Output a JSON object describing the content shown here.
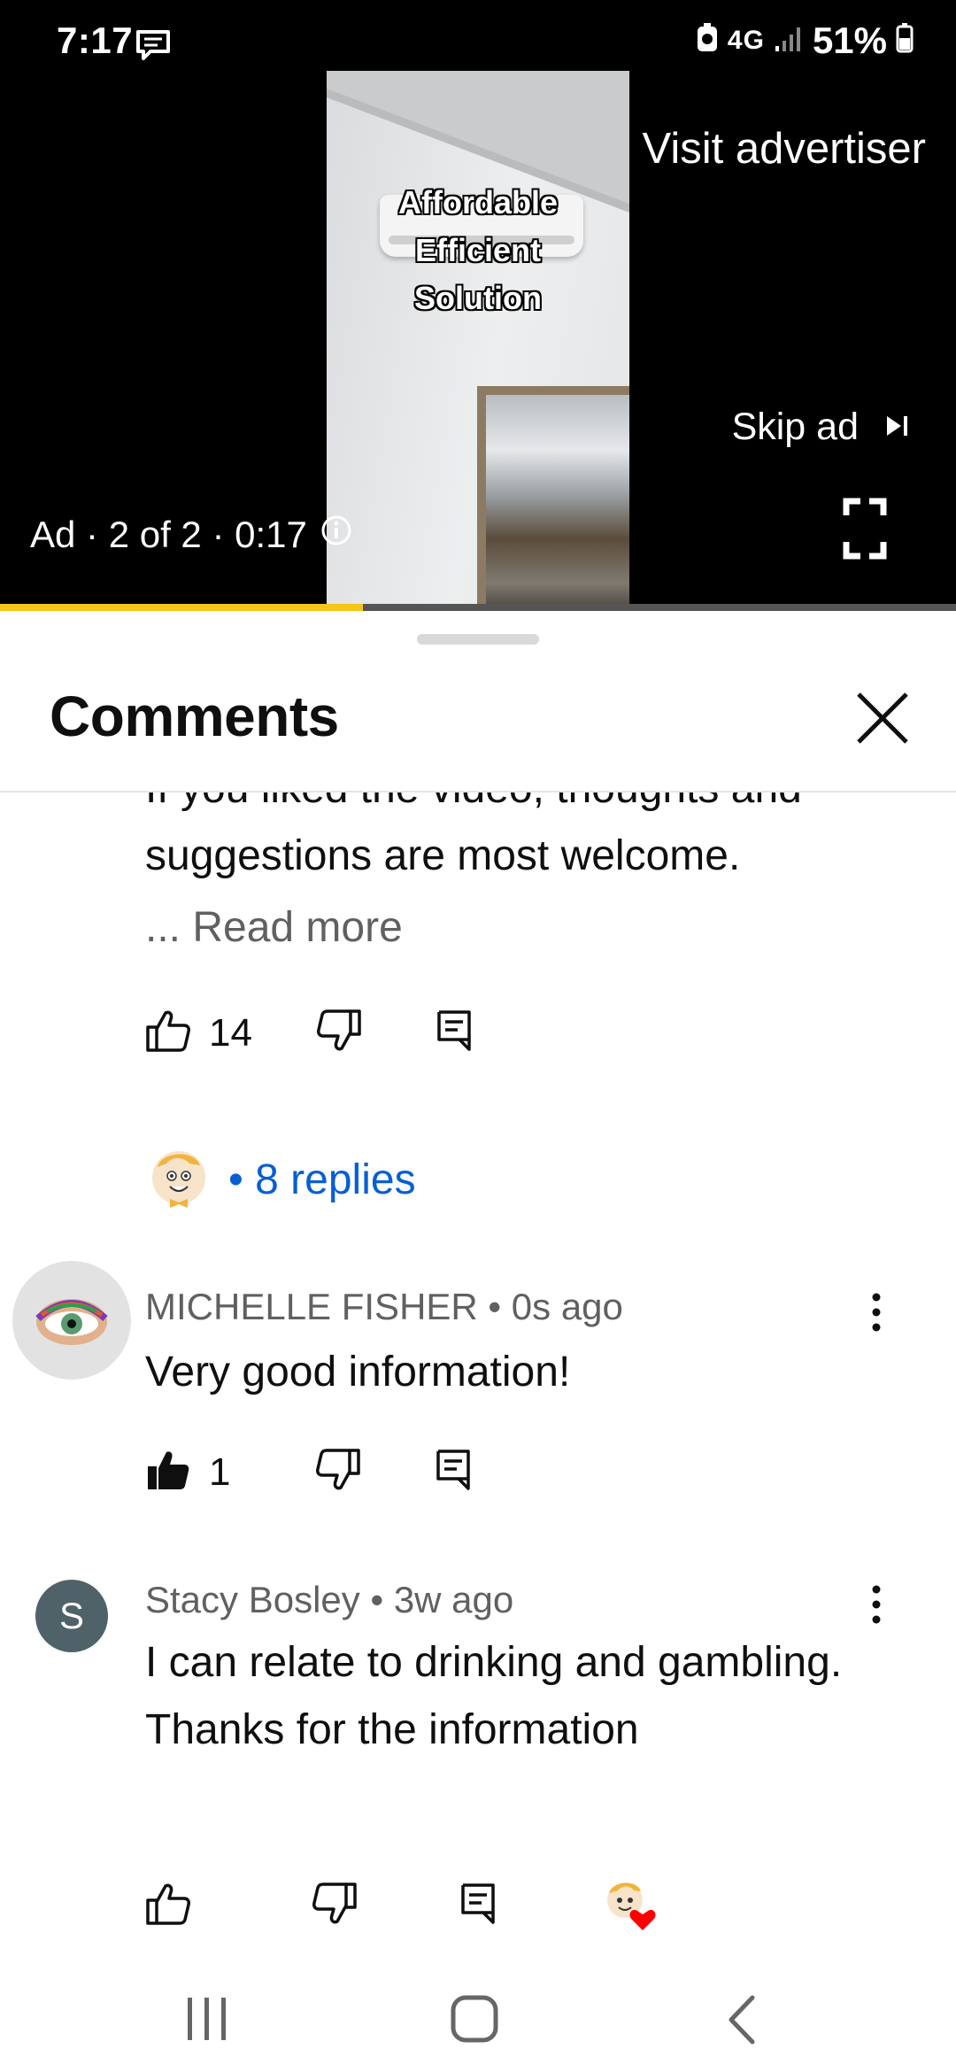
{
  "status_bar": {
    "time": "7:17",
    "network": "4G",
    "battery": "51%"
  },
  "ad": {
    "caption_lines": [
      "Affordable",
      "Efficient",
      "Solution"
    ],
    "visit_label": "Visit advertiser",
    "skip_label": "Skip ad",
    "info": "Ad · 2 of 2 · 0:17",
    "progress": 0.38
  },
  "comments": {
    "title": "Comments",
    "first": {
      "line1": "If you liked the video, thoughts and",
      "line2": "suggestions are most welcome.",
      "read_more": "... Read more",
      "likes": "14",
      "replies": "• 8 replies"
    },
    "items": [
      {
        "author": "MICHELLE FISHER",
        "age": "0s ago",
        "text": "Very good information!",
        "likes": "1",
        "avatar": "eye-avatar"
      },
      {
        "author": "Stacy Bosley",
        "age": "3w ago",
        "text": "I can relate to drinking and gambling. Thanks for the information",
        "likes": "",
        "avatar_letter": "S"
      }
    ]
  },
  "icons": [
    "chat-bubble-icon",
    "signal-icon",
    "battery-icon",
    "info-icon",
    "skip-next-icon",
    "fullscreen-icon",
    "close-icon",
    "like-icon",
    "dislike-icon",
    "reply-icon",
    "more-vertical-icon",
    "creator-heart-icon",
    "recent-apps-icon",
    "home-icon",
    "back-icon"
  ],
  "colors": {
    "accent_link": "#065fd4",
    "progress": "#f5c518",
    "heart": "#ff0000"
  }
}
